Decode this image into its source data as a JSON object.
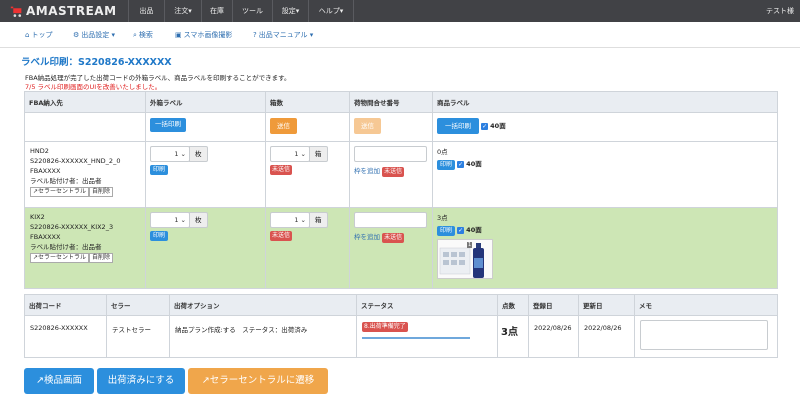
{
  "app": {
    "logo": "AMASTREAM",
    "user": "テスト様"
  },
  "nav": [
    {
      "label": "出品"
    },
    {
      "label": "注文▾"
    },
    {
      "label": "在庫"
    },
    {
      "label": "ツール"
    },
    {
      "label": "設定▾"
    },
    {
      "label": "ヘルプ▾"
    }
  ],
  "subnav": [
    {
      "icon": "home-icon",
      "glyph": "⌂",
      "label": "トップ"
    },
    {
      "icon": "gear-icon",
      "glyph": "⚙",
      "label": "出品設定 ▾"
    },
    {
      "icon": "search-icon",
      "glyph": "⌕",
      "label": "検索"
    },
    {
      "icon": "image-icon",
      "glyph": "▣",
      "label": "スマホ画像撮影"
    },
    {
      "icon": "question-icon",
      "glyph": "?",
      "label": "出品マニュアル ▾"
    }
  ],
  "page": {
    "title": "ラベル印刷：S220826-XXXXXX",
    "description": "FBA納品処理が完了した出荷コードの外箱ラベル、商品ラベルを印刷することができます。",
    "notice": "7/5 ラベル印刷画面のUIを改善いたしました。"
  },
  "main_table": {
    "headers": [
      "FBA納入先",
      "外箱ラベル",
      "箱数",
      "荷物問合せ番号",
      "商品ラベル"
    ],
    "bulk": {
      "outer_print": "一括印刷",
      "box_send": "送信",
      "tracking_send": "送信",
      "product_print": "一括印刷",
      "product_count": "40面"
    },
    "rows": [
      {
        "center": "HND2",
        "shipment": "S220826-XXXXXX_HND_2_0",
        "fba": "FBAXXXX",
        "labeler": "ラベル貼付け者：出品者",
        "seller_central": "セラーセントラル",
        "self_delete": "自削除",
        "qty": "1",
        "unit_outer": "枚",
        "print": "印刷",
        "boxes": "1",
        "unit_box": "箱",
        "status": "未送信",
        "add_frame": "枠を追加",
        "status_tracking": "未送信",
        "points": "0点",
        "product_print": "印刷",
        "product_count": "40面"
      },
      {
        "center": "KIX2",
        "shipment": "S220826-XXXXXX_KIX2_3",
        "fba": "FBAXXXX",
        "labeler": "ラベル貼付け者：出品者",
        "seller_central": "セラーセントラル",
        "self_delete": "自削除",
        "qty": "1",
        "unit_outer": "枚",
        "print": "印刷",
        "boxes": "1",
        "unit_box": "箱",
        "status": "未送信",
        "add_frame": "枠を追加",
        "status_tracking": "未送信",
        "points": "3点",
        "product_print": "印刷",
        "product_count": "40面",
        "thumb_badge": "1"
      }
    ]
  },
  "ship_table": {
    "headers": [
      "出荷コード",
      "セラー",
      "出荷オプション",
      "ステータス",
      "点数",
      "登録日",
      "更新日",
      "メモ"
    ],
    "row": {
      "code": "S220826-XXXXXX",
      "seller": "テストセラー",
      "option": "納品プラン作成:する　ステータス：出荷済み",
      "status": "8.出荷準備完了",
      "progress": 0.6,
      "points": "3点",
      "registered": "2022/08/26",
      "updated": "2022/08/26"
    }
  },
  "actions": {
    "inspect": "検品画面",
    "mark_shipped": "出荷済みにする",
    "seller_central": "セラーセントラルに遷移"
  },
  "colors": {
    "nav_bg": "#414246",
    "accent_blue": "#2c8fdd",
    "orange": "#ef9a3a",
    "green_row": "#cde6b5",
    "red": "#d9534f"
  }
}
